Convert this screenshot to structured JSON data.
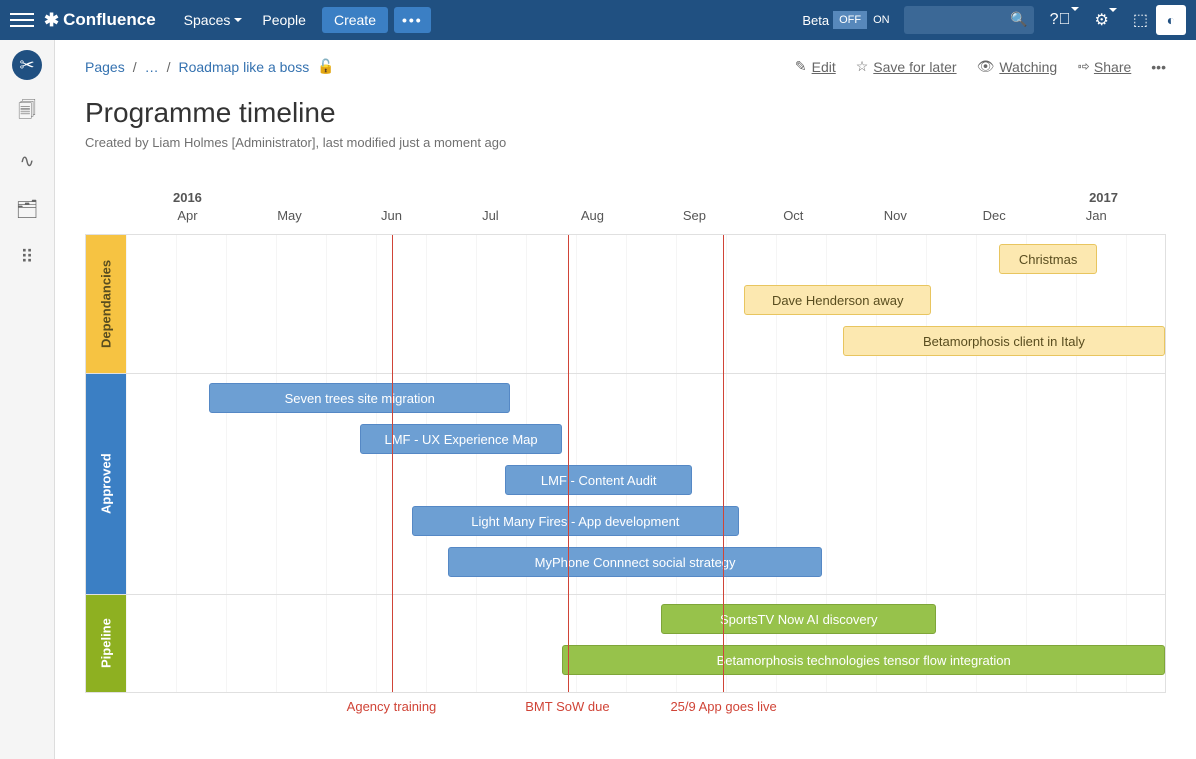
{
  "header": {
    "brand": "Confluence",
    "nav": {
      "spaces": "Spaces",
      "people": "People",
      "create": "Create"
    },
    "beta": {
      "label": "Beta",
      "off": "OFF",
      "on": "ON"
    }
  },
  "breadcrumbs": {
    "root": "Pages",
    "ellipsis": "…",
    "current": "Roadmap like a boss"
  },
  "actions": {
    "edit": "Edit",
    "save": "Save for later",
    "watch": "Watching",
    "share": "Share"
  },
  "page": {
    "title": "Programme timeline",
    "meta": "Created by Liam Holmes [Administrator], last modified just a moment ago"
  },
  "chart_data": {
    "type": "gantt",
    "x_range": {
      "start": "2016-03-15",
      "end": "2017-01-31"
    },
    "years": [
      {
        "label": "2016",
        "pos_pct": 6.0
      },
      {
        "label": "2017",
        "pos_pct": 94.0
      }
    ],
    "months": [
      {
        "label": "Apr",
        "pos_pct": 6.0
      },
      {
        "label": "May",
        "pos_pct": 15.8
      },
      {
        "label": "Jun",
        "pos_pct": 25.6
      },
      {
        "label": "Jul",
        "pos_pct": 35.1
      },
      {
        "label": "Aug",
        "pos_pct": 44.9
      },
      {
        "label": "Sep",
        "pos_pct": 54.7
      },
      {
        "label": "Oct",
        "pos_pct": 64.2
      },
      {
        "label": "Nov",
        "pos_pct": 74.0
      },
      {
        "label": "Dec",
        "pos_pct": 83.5
      },
      {
        "label": "Jan",
        "pos_pct": 93.3
      }
    ],
    "lanes": [
      {
        "id": "dep",
        "label": "Dependancies",
        "color": "yellow",
        "rows": [
          [
            {
              "label": "Christmas",
              "left_pct": 84.0,
              "width_pct": 9.5
            }
          ],
          [
            {
              "label": "Dave Henderson away",
              "left_pct": 59.5,
              "width_pct": 18.0
            }
          ],
          [
            {
              "label": "Betamorphosis client in Italy",
              "left_pct": 69.0,
              "width_pct": 31.0
            }
          ]
        ]
      },
      {
        "id": "app",
        "label": "Approved",
        "color": "blue",
        "rows": [
          [
            {
              "label": "Seven trees site migration",
              "left_pct": 8.0,
              "width_pct": 29.0
            }
          ],
          [
            {
              "label": "LMF - UX Experience Map",
              "left_pct": 22.5,
              "width_pct": 19.5
            }
          ],
          [
            {
              "label": "LMF - Content Audit",
              "left_pct": 36.5,
              "width_pct": 18.0
            }
          ],
          [
            {
              "label": "Light Many Fires - App development",
              "left_pct": 27.5,
              "width_pct": 31.5
            }
          ],
          [
            {
              "label": "MyPhone Connnect social strategy",
              "left_pct": 31.0,
              "width_pct": 36.0
            }
          ]
        ]
      },
      {
        "id": "pipe",
        "label": "Pipeline",
        "color": "green",
        "rows": [
          [
            {
              "label": "SportsTV Now AI discovery",
              "left_pct": 51.5,
              "width_pct": 26.5
            }
          ],
          [
            {
              "label": "Betamorphosis technologies tensor flow integration",
              "left_pct": 42.0,
              "width_pct": 58.0
            }
          ]
        ]
      }
    ],
    "markers": [
      {
        "label": "Agency training",
        "pos_pct": 25.6
      },
      {
        "label": "BMT SoW due",
        "pos_pct": 42.5
      },
      {
        "label": "25/9 App goes live",
        "pos_pct": 57.5
      }
    ]
  }
}
